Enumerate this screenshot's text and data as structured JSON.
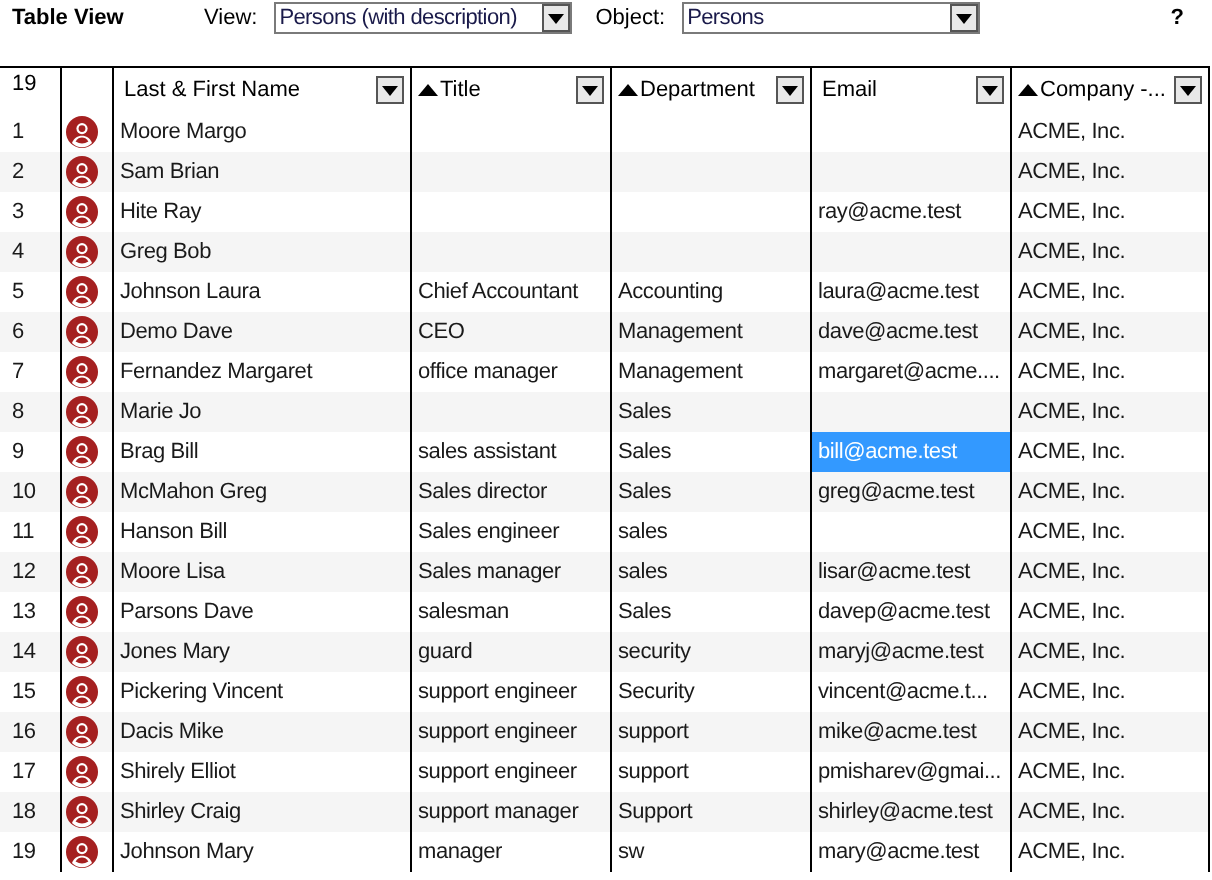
{
  "toolbar": {
    "title": "Table View",
    "view_label": "View:",
    "view_value": "Persons (with description)",
    "object_label": "Object:",
    "object_value": "Persons",
    "help": "?"
  },
  "table": {
    "row_count": "19",
    "columns": [
      {
        "label": "Last & First Name",
        "sorted": false
      },
      {
        "label": "Title",
        "sorted": true
      },
      {
        "label": "Department",
        "sorted": true
      },
      {
        "label": "Email",
        "sorted": false
      },
      {
        "label": "Company -...",
        "sorted": true
      }
    ],
    "rows": [
      {
        "number": "1",
        "cells": [
          "Moore Margo",
          "",
          "",
          "",
          "ACME, Inc."
        ],
        "email_selected": false
      },
      {
        "number": "2",
        "cells": [
          "Sam Brian",
          "",
          "",
          "",
          "ACME, Inc."
        ],
        "email_selected": false
      },
      {
        "number": "3",
        "cells": [
          "Hite Ray",
          "",
          "",
          "ray@acme.test",
          "ACME, Inc."
        ],
        "email_selected": false
      },
      {
        "number": "4",
        "cells": [
          "Greg Bob",
          "",
          "",
          "",
          "ACME, Inc."
        ],
        "email_selected": false
      },
      {
        "number": "5",
        "cells": [
          "Johnson Laura",
          "Chief Accountant",
          "Accounting",
          "laura@acme.test",
          "ACME, Inc."
        ],
        "email_selected": false
      },
      {
        "number": "6",
        "cells": [
          "Demo Dave",
          "CEO",
          "Management",
          "dave@acme.test",
          "ACME, Inc."
        ],
        "email_selected": false
      },
      {
        "number": "7",
        "cells": [
          "Fernandez Margaret",
          "office manager",
          "Management",
          "margaret@acme....",
          "ACME, Inc."
        ],
        "email_selected": false
      },
      {
        "number": "8",
        "cells": [
          "Marie Jo",
          "",
          "Sales",
          "",
          "ACME, Inc."
        ],
        "email_selected": false
      },
      {
        "number": "9",
        "cells": [
          "Brag Bill",
          "sales assistant",
          "Sales",
          "bill@acme.test",
          "ACME, Inc."
        ],
        "email_selected": true
      },
      {
        "number": "10",
        "cells": [
          "McMahon Greg",
          "Sales director",
          "Sales",
          "greg@acme.test",
          "ACME, Inc."
        ],
        "email_selected": false
      },
      {
        "number": "11",
        "cells": [
          "Hanson Bill",
          "Sales engineer",
          "sales",
          "",
          "ACME, Inc."
        ],
        "email_selected": false
      },
      {
        "number": "12",
        "cells": [
          "Moore Lisa",
          "Sales manager",
          "sales",
          "lisar@acme.test",
          "ACME, Inc."
        ],
        "email_selected": false
      },
      {
        "number": "13",
        "cells": [
          "Parsons Dave",
          "salesman",
          "Sales",
          "davep@acme.test",
          "ACME, Inc."
        ],
        "email_selected": false
      },
      {
        "number": "14",
        "cells": [
          "Jones Mary",
          "guard",
          "security",
          "maryj@acme.test",
          "ACME, Inc."
        ],
        "email_selected": false
      },
      {
        "number": "15",
        "cells": [
          "Pickering Vincent",
          "support engineer",
          "Security",
          "vincent@acme.t...",
          "ACME, Inc."
        ],
        "email_selected": false
      },
      {
        "number": "16",
        "cells": [
          "Dacis Mike",
          "support engineer",
          "support",
          "mike@acme.test",
          "ACME, Inc."
        ],
        "email_selected": false
      },
      {
        "number": "17",
        "cells": [
          "Shirely Elliot",
          "support engineer",
          "support",
          "pmisharev@gmai...",
          "ACME, Inc."
        ],
        "email_selected": false
      },
      {
        "number": "18",
        "cells": [
          "Shirley Craig",
          "support manager",
          "Support",
          "shirley@acme.test",
          "ACME, Inc."
        ],
        "email_selected": false
      },
      {
        "number": "19",
        "cells": [
          "Johnson Mary",
          "manager",
          "sw",
          "mary@acme.test",
          "ACME, Inc."
        ],
        "email_selected": false
      }
    ]
  }
}
